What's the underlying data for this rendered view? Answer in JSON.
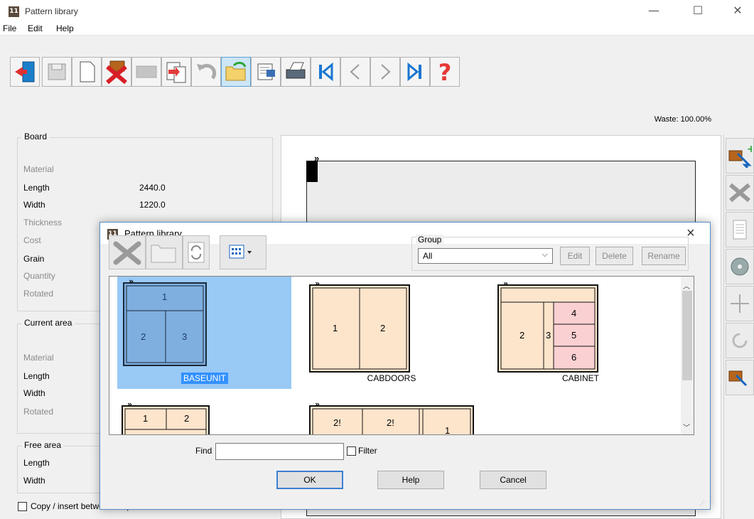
{
  "window": {
    "title": "Pattern library",
    "icon_text": "11"
  },
  "menu": [
    "File",
    "Edit",
    "Help"
  ],
  "waste_label": "Waste: 100.00%",
  "board": {
    "title": "Board",
    "rows": [
      {
        "label": "Material",
        "value": ""
      },
      {
        "label": "Length",
        "value": "2440.0"
      },
      {
        "label": "Width",
        "value": "1220.0"
      },
      {
        "label": "Thickness",
        "value": ""
      },
      {
        "label": "Cost",
        "value": ""
      },
      {
        "label": "Grain",
        "value": ""
      },
      {
        "label": "Quantity",
        "value": ""
      },
      {
        "label": "Rotated",
        "value": ""
      }
    ]
  },
  "current_area": {
    "title": "Current area",
    "rows": [
      "Material",
      "Length",
      "Width",
      "Rotated"
    ]
  },
  "free_area": {
    "title": "Free area",
    "rows": [
      "Length",
      "Width"
    ]
  },
  "copy_insert_label": "Copy / insert between strips",
  "dialog": {
    "title": "Pattern library",
    "icon_text": "11",
    "group_label": "Group",
    "group_value": "All",
    "edit_label": "Edit",
    "delete_label": "Delete",
    "rename_label": "Rename",
    "patterns": [
      {
        "name": "BASEUNIT",
        "selected": true,
        "parts": [
          "1",
          "2",
          "3"
        ]
      },
      {
        "name": "CABDOORS",
        "selected": false,
        "parts": [
          "1",
          "2"
        ]
      },
      {
        "name": "CABINET",
        "selected": false,
        "parts": [
          "2",
          "3",
          "4",
          "5",
          "6"
        ]
      },
      {
        "name": "",
        "selected": false,
        "parts": [
          "1",
          "2"
        ]
      },
      {
        "name": "",
        "selected": false,
        "parts": [
          "2!",
          "2!",
          "1"
        ]
      }
    ],
    "find_label": "Find",
    "find_value": "",
    "filter_label": "Filter",
    "ok_label": "OK",
    "help_label": "Help",
    "cancel_label": "Cancel",
    "close_glyph": "×"
  },
  "colors": {
    "selection": "#99c9f5",
    "part_fill": "#fde5cc",
    "part_red": "#fbd0d3",
    "dialog_border": "#5a8cc5"
  }
}
